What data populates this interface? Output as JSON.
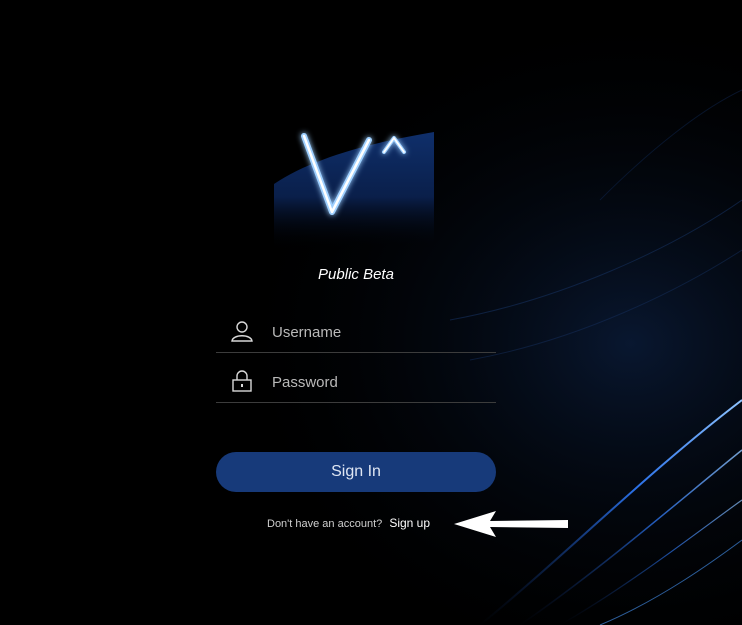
{
  "app": {
    "tagline": "Public Beta"
  },
  "login": {
    "username_placeholder": "Username",
    "password_placeholder": "Password",
    "signin_label": "Sign In",
    "no_account_text": "Don't have an account?",
    "signup_label": "Sign up"
  },
  "icons": {
    "logo": "v-caret-logo",
    "username": "user-icon",
    "password": "lock-icon",
    "annotation": "arrow-left-icon"
  },
  "colors": {
    "background": "#000000",
    "button": "#173a7a",
    "logo_glow": "#2f8bff",
    "text": "#ffffff"
  }
}
